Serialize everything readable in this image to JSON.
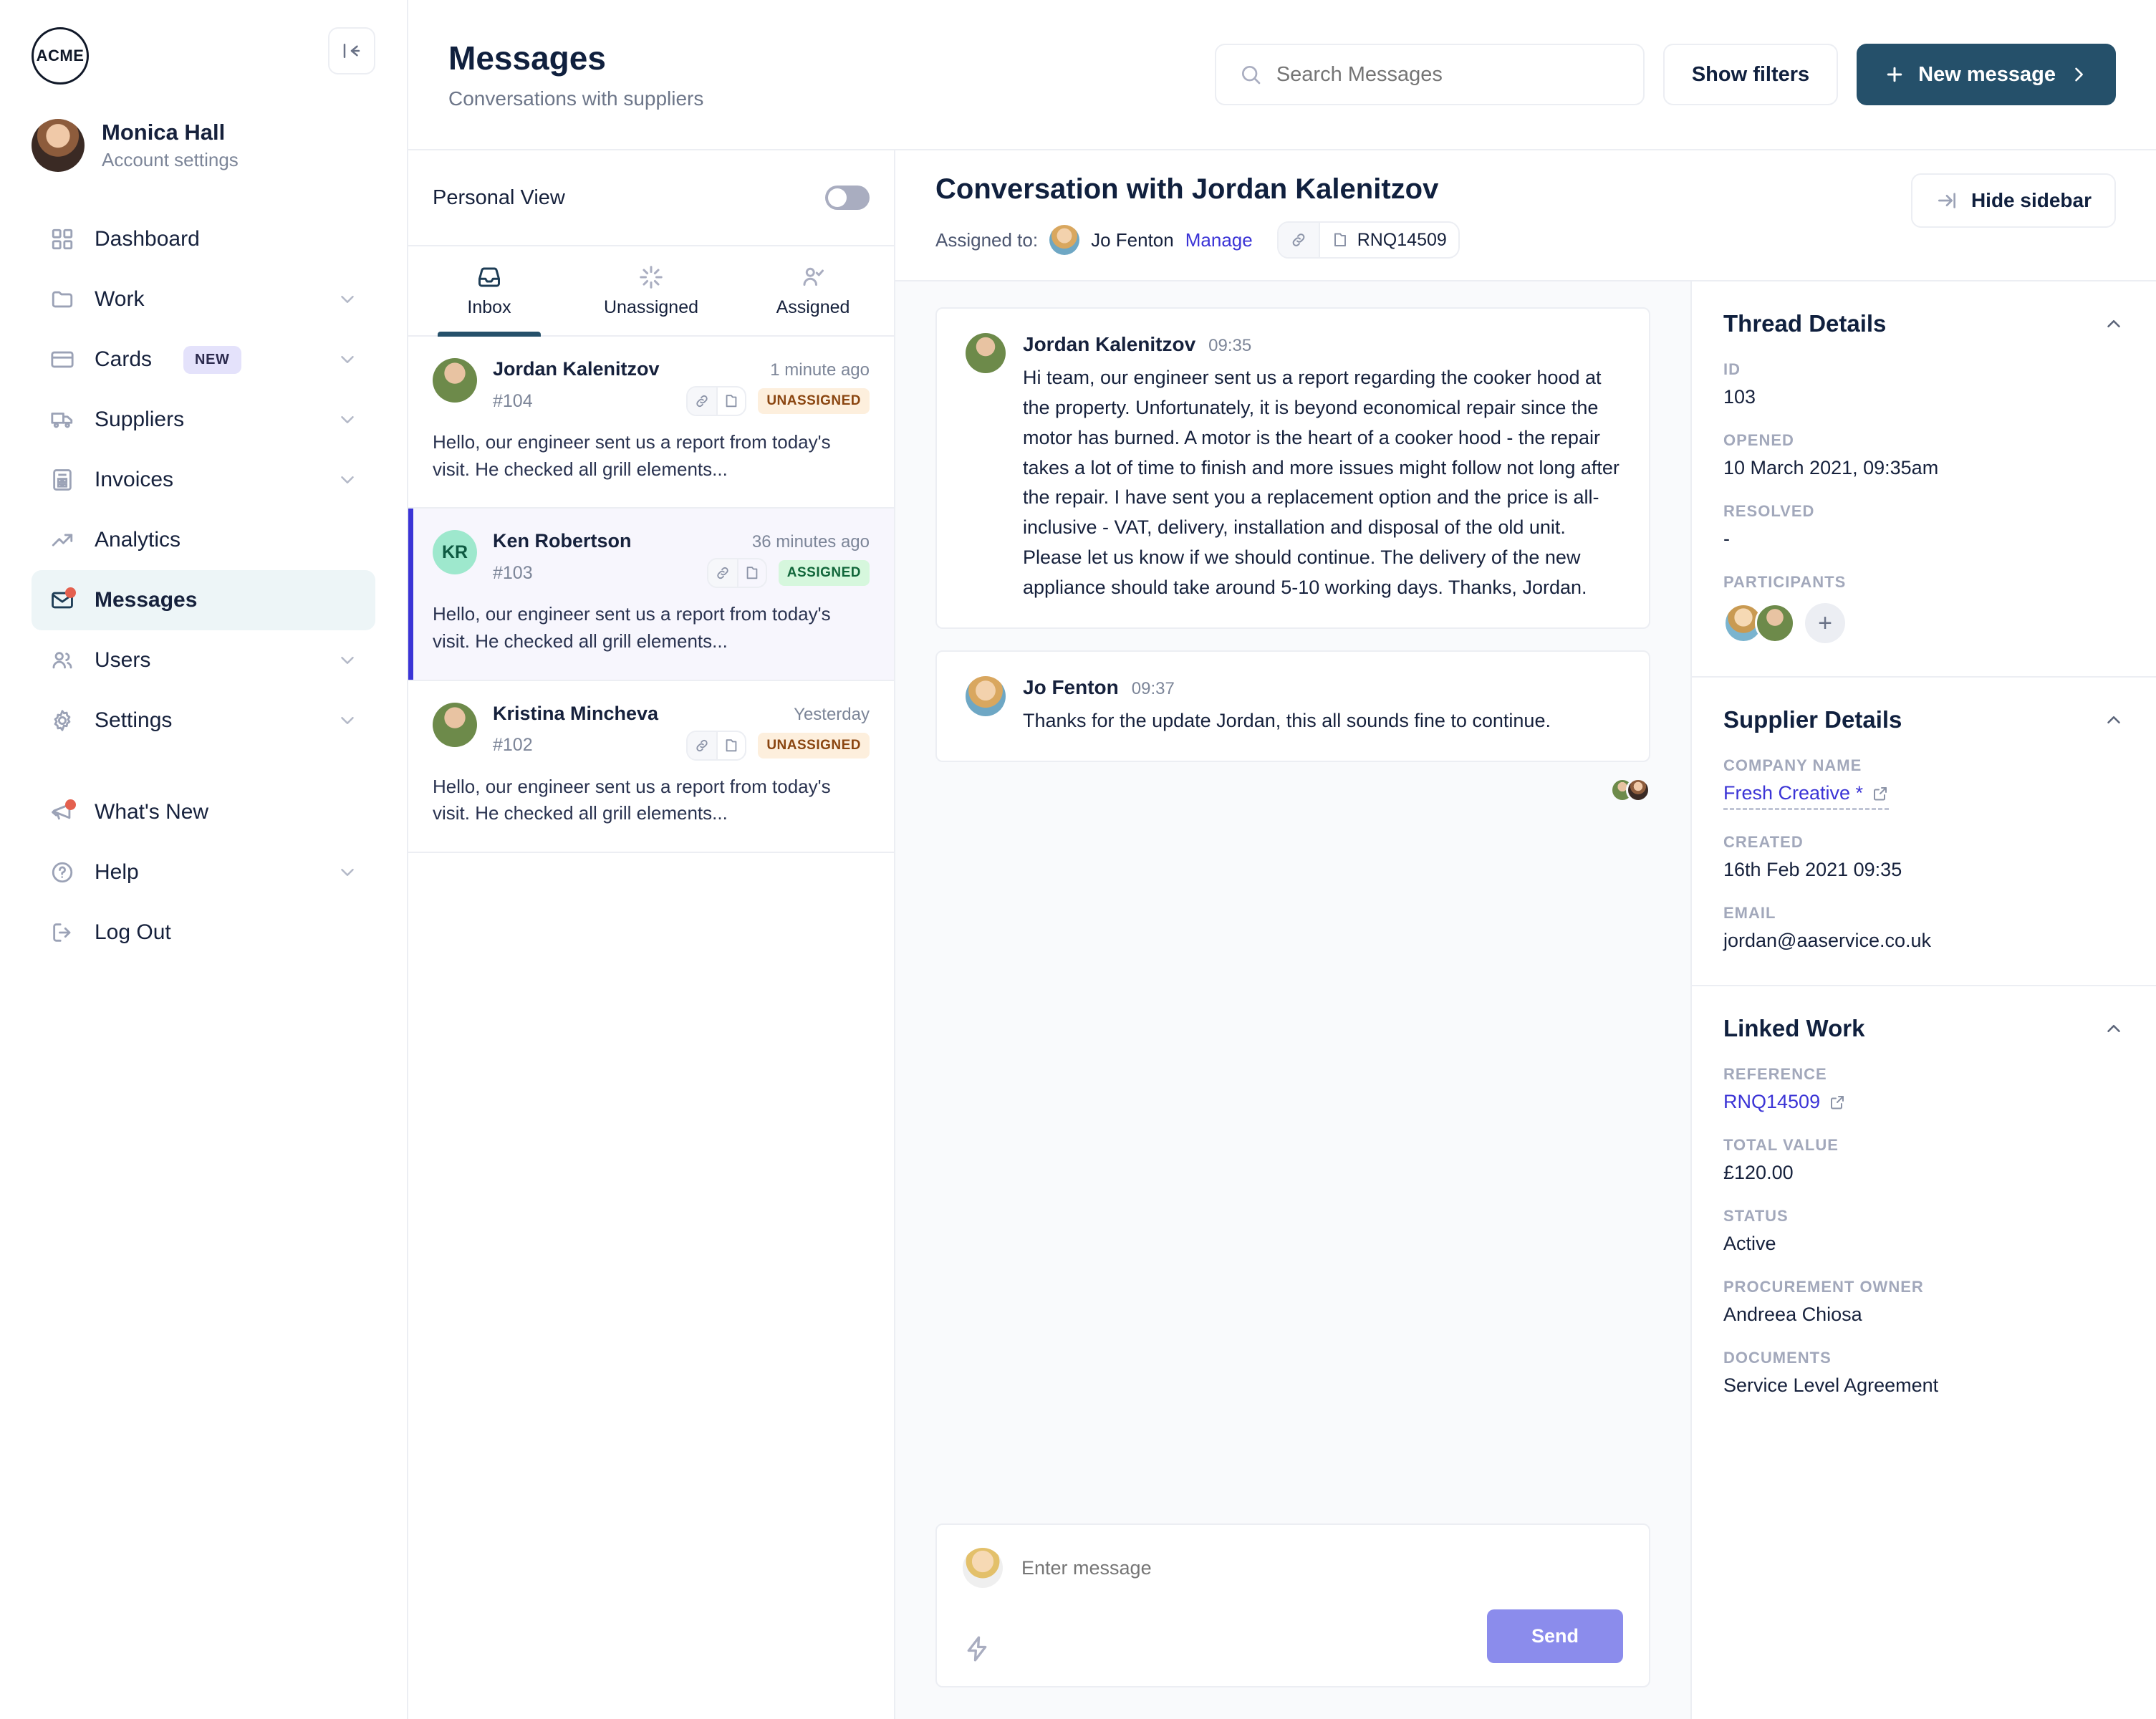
{
  "brand": {
    "logo_text": "ACME",
    "accent_dark": "#25506a",
    "accent_purple": "#8b8cec",
    "link_blue": "#3b34d6"
  },
  "sidebar": {
    "user": {
      "name": "Monica Hall",
      "subtitle": "Account settings"
    },
    "items": [
      {
        "label": "Dashboard",
        "icon": "grid-icon",
        "chevron": false,
        "badge": null,
        "dot": false,
        "active": false
      },
      {
        "label": "Work",
        "icon": "folder-icon",
        "chevron": true,
        "badge": null,
        "dot": false,
        "active": false
      },
      {
        "label": "Cards",
        "icon": "credit-card-icon",
        "chevron": true,
        "badge": "NEW",
        "dot": false,
        "active": false
      },
      {
        "label": "Suppliers",
        "icon": "truck-icon",
        "chevron": true,
        "badge": null,
        "dot": false,
        "active": false
      },
      {
        "label": "Invoices",
        "icon": "invoice-icon",
        "chevron": true,
        "badge": null,
        "dot": false,
        "active": false
      },
      {
        "label": "Analytics",
        "icon": "trending-up-icon",
        "chevron": false,
        "badge": null,
        "dot": false,
        "active": false
      },
      {
        "label": "Messages",
        "icon": "mail-icon",
        "chevron": false,
        "badge": null,
        "dot": true,
        "active": true
      },
      {
        "label": "Users",
        "icon": "users-icon",
        "chevron": true,
        "badge": null,
        "dot": false,
        "active": false
      },
      {
        "label": "Settings",
        "icon": "gear-icon",
        "chevron": true,
        "badge": null,
        "dot": false,
        "active": false
      }
    ],
    "footer_items": [
      {
        "label": "What's New",
        "icon": "megaphone-icon",
        "chevron": false,
        "dot": true
      },
      {
        "label": "Help",
        "icon": "question-circle-icon",
        "chevron": true,
        "dot": false
      },
      {
        "label": "Log Out",
        "icon": "logout-icon",
        "chevron": false,
        "dot": false
      }
    ]
  },
  "header": {
    "title": "Messages",
    "subtitle": "Conversations with suppliers",
    "search_placeholder": "Search Messages",
    "search_value": "",
    "filters_label": "Show filters",
    "new_message_label": "New message"
  },
  "list_panel": {
    "personal_view_label": "Personal View",
    "personal_view_on": false,
    "tabs": [
      {
        "label": "Inbox",
        "icon": "inbox-icon",
        "active": true
      },
      {
        "label": "Unassigned",
        "icon": "spinner-icon",
        "active": false
      },
      {
        "label": "Assigned",
        "icon": "user-check-icon",
        "active": false
      }
    ],
    "messages": [
      {
        "name": "Jordan Kalenitzov",
        "time": "1 minute ago",
        "id": "#104",
        "status": "UNASSIGNED",
        "status_kind": "unassigned",
        "preview": "Hello, our engineer sent us a report from today's visit. He checked all grill elements...",
        "avatar_kind": "photo",
        "initials": "",
        "selected": false
      },
      {
        "name": "Ken Robertson",
        "time": "36 minutes ago",
        "id": "#103",
        "status": "ASSIGNED",
        "status_kind": "assigned",
        "preview": "Hello, our engineer sent us a report from today's visit. He checked all grill elements...",
        "avatar_kind": "initials",
        "initials": "KR",
        "selected": true
      },
      {
        "name": "Kristina Mincheva",
        "time": "Yesterday",
        "id": "#102",
        "status": "UNASSIGNED",
        "status_kind": "unassigned",
        "preview": "Hello, our engineer sent us a report from today's visit. He checked all grill elements...",
        "avatar_kind": "photo",
        "initials": "",
        "selected": false
      }
    ]
  },
  "conversation": {
    "title": "Conversation with Jordan Kalenitzov",
    "assigned_label": "Assigned to:",
    "assignee": "Jo Fenton",
    "manage_label": "Manage",
    "reference_chip": "RNQ14509",
    "hide_sidebar_label": "Hide sidebar",
    "messages": [
      {
        "author": "Jordan Kalenitzov",
        "time": "09:35",
        "avatar_kind": "jordan",
        "text": "Hi team, our engineer sent us a report regarding the cooker hood at the property. Unfortunately, it is beyond economical repair since the motor has burned. A motor is the heart of a cooker hood - the repair takes a lot of time to finish and more issues might follow not long after the repair. I have sent you a replacement option and the price is all-inclusive - VAT, delivery, installation and disposal of the old unit. Please let us know if we should continue. The delivery of the new appliance should take around 5-10 working days. Thanks, Jordan."
      },
      {
        "author": "Jo Fenton",
        "time": "09:37",
        "avatar_kind": "jo",
        "text": "Thanks for the update Jordan, this all sounds fine to continue."
      }
    ],
    "composer": {
      "placeholder": "Enter message",
      "value": "",
      "send_label": "Send"
    }
  },
  "details_panel": {
    "thread": {
      "title": "Thread Details",
      "fields": [
        {
          "label": "ID",
          "value": "103"
        },
        {
          "label": "OPENED",
          "value": "10 March 2021, 09:35am"
        },
        {
          "label": "RESOLVED",
          "value": "-"
        }
      ],
      "participants_label": "PARTICIPANTS",
      "participants": [
        "Jo Fenton",
        "Jordan Kalenitzov"
      ],
      "add_participant_label": "+"
    },
    "supplier": {
      "title": "Supplier Details",
      "company_label": "COMPANY NAME",
      "company_value": "Fresh Creative *",
      "created_label": "CREATED",
      "created_value": "16th Feb 2021 09:35",
      "email_label": "EMAIL",
      "email_value": "jordan@aaservice.co.uk"
    },
    "linked_work": {
      "title": "Linked Work",
      "reference_label": "REFERENCE",
      "reference_value": "RNQ14509",
      "total_label": "TOTAL VALUE",
      "total_value": "£120.00",
      "status_label": "STATUS",
      "status_value": "Active",
      "owner_label": "PROCUREMENT OWNER",
      "owner_value": "Andreea Chiosa",
      "documents_label": "DOCUMENTS",
      "documents_value": "Service Level Agreement"
    }
  }
}
